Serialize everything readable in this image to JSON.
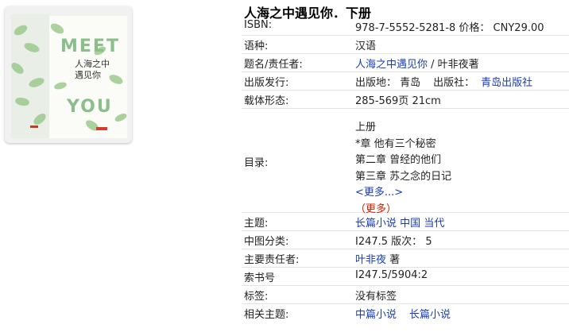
{
  "book": {
    "title": "人海之中遇见你．下册",
    "cover": {
      "word_top": "MEET",
      "word_bottom": "YOU",
      "handwritten_line1": "人海之中",
      "handwritten_line2": "遇见你"
    }
  },
  "fields": {
    "isbn": {
      "label": "ISBN:",
      "value": "978-7-5552-5281-8 价格： CNY29.00"
    },
    "language": {
      "label": "语种:",
      "value": "汉语"
    },
    "title_author": {
      "label": "题名/责任者:",
      "link": "人海之中遇见你",
      "rest": " / 叶非夜著"
    },
    "publisher": {
      "label": "出版发行:",
      "place": "出版地： 青岛",
      "publisher_label": "出版社：",
      "publisher_link": "青岛出版社"
    },
    "physical": {
      "label": "载体形态:",
      "value": "285-569页 21cm"
    },
    "toc": {
      "label": "目录:",
      "lines": [
        "上册",
        "*章 他有三个秘密",
        "第二章 曾经的他们",
        "第三章 苏之念的日记"
      ],
      "more_link": "<更多...>",
      "more_red": "（更多）"
    },
    "subject": {
      "label": "主题:",
      "links": [
        "长篇小说",
        "中国",
        "当代"
      ]
    },
    "clc": {
      "label": "中图分类:",
      "value": "I247.5 版次： 5"
    },
    "main_author": {
      "label": "主要责任者:",
      "link": "叶非夜",
      "rest": " 著"
    },
    "call_number": {
      "label": "索书号",
      "value": "I247.5/5904:2"
    },
    "tags": {
      "label": "标签:",
      "value": "没有标签"
    },
    "related": {
      "label": "相关主题:",
      "links": [
        "中篇小说",
        "长篇小说"
      ]
    }
  },
  "colors": {
    "link": "#1a3db4",
    "red": "#cc2200",
    "leaf": "#8bbf8a"
  }
}
